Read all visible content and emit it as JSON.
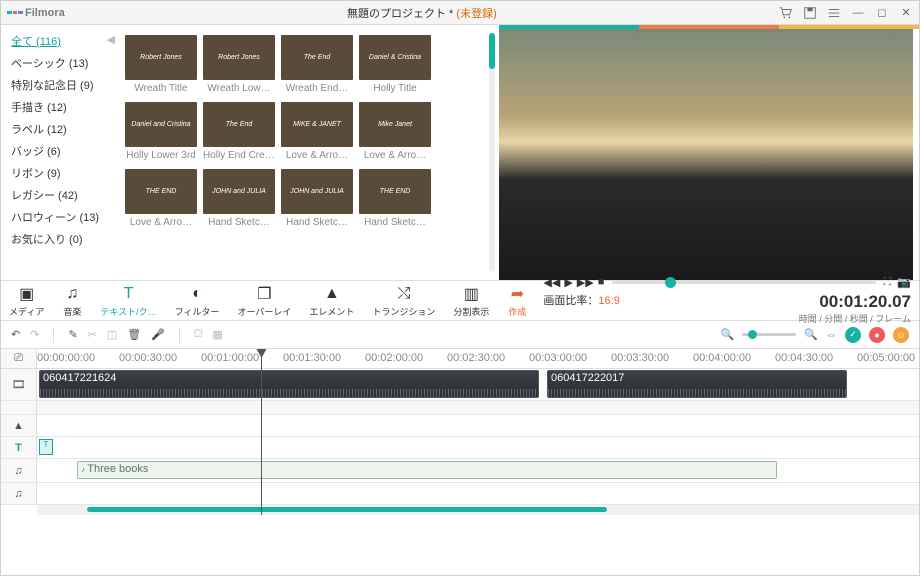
{
  "titlebar": {
    "logo": "Filmora",
    "project": "無題のプロジェクト *",
    "unreg": "(未登録)"
  },
  "sidebar": {
    "items": [
      {
        "label": "全て (116)",
        "active": true
      },
      {
        "label": "ベーシック (13)"
      },
      {
        "label": "特別な記念日 (9)"
      },
      {
        "label": "手描き (12)"
      },
      {
        "label": "ラベル (12)"
      },
      {
        "label": "バッジ (6)"
      },
      {
        "label": "リボン (9)"
      },
      {
        "label": "レガシー (42)"
      },
      {
        "label": "ハロウィーン (13)"
      },
      {
        "label": "お気に入り (0)"
      }
    ]
  },
  "gallery": [
    {
      "thumb": "Robert Jones",
      "label": "Wreath Title"
    },
    {
      "thumb": "Robert Jones",
      "label": "Wreath Low…"
    },
    {
      "thumb": "The End",
      "label": "Wreath End…"
    },
    {
      "thumb": "Daniel & Cristina",
      "label": "Holly Title"
    },
    {
      "thumb": "Daniel and Cristina",
      "label": "Holly Lower 3rd"
    },
    {
      "thumb": "The End",
      "label": "Holly End Credit"
    },
    {
      "thumb": "MIKE & JANET",
      "label": "Love & Arro…"
    },
    {
      "thumb": "Mike Janet",
      "label": "Love & Arro…"
    },
    {
      "thumb": "THE END",
      "label": "Love & Arro…"
    },
    {
      "thumb": "JOHN and JULIA",
      "label": "Hand Sketc…"
    },
    {
      "thumb": "JOHN and JULIA",
      "label": "Hand Sketc…"
    },
    {
      "thumb": "THE END",
      "label": "Hand Sketc…"
    }
  ],
  "tabs": {
    "media": "メディア",
    "music": "音楽",
    "text": "テキスト/ク…",
    "filter": "フィルター",
    "overlay": "オーバーレイ",
    "element": "エレメント",
    "transition": "トランジション",
    "split": "分割表示",
    "create": "作成"
  },
  "preview": {
    "ratio_label": "画面比率：",
    "ratio_value": "16:9",
    "timecode": "00:01:20.07",
    "timecode_sub": "時間 / 分間 / 秒間 / フレーム"
  },
  "ruler": [
    "00:00:00:00",
    "00:00:30:00",
    "00:01:00:00",
    "00:01:30:00",
    "00:02:00:00",
    "00:02:30:00",
    "00:03:00:00",
    "00:03:30:00",
    "00:04:00:00",
    "00:04:30:00",
    "00:05:00:00"
  ],
  "clips": {
    "video1": "060417221624",
    "video2": "060417222017",
    "audio": "Three books"
  }
}
